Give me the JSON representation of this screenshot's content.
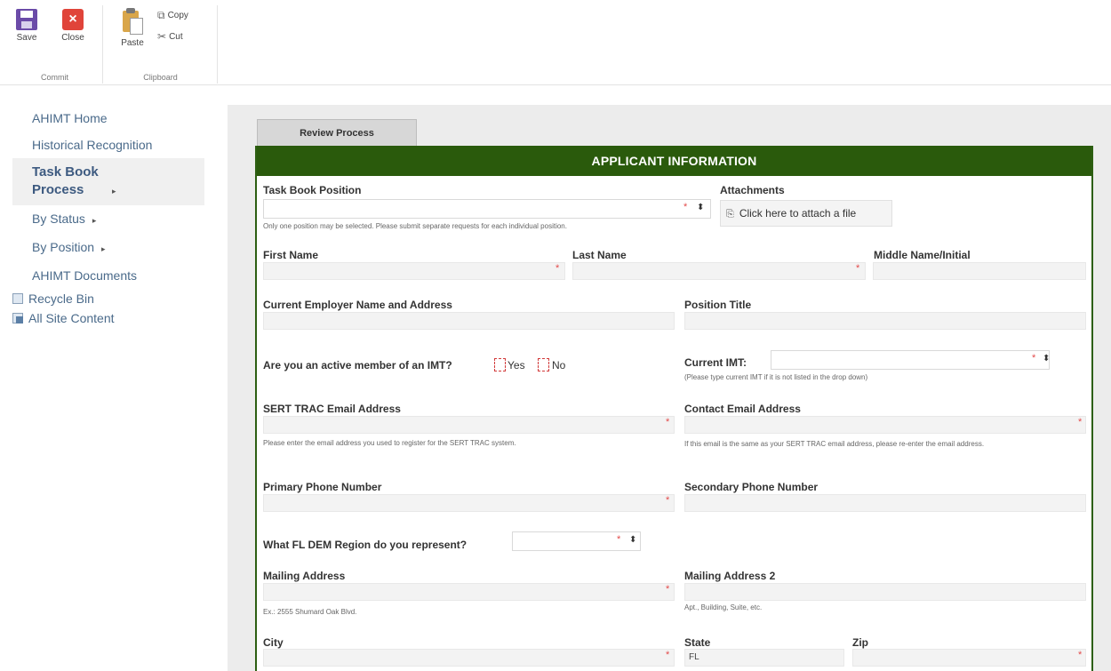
{
  "ribbon": {
    "commit": {
      "save": "Save",
      "close": "Close",
      "label": "Commit"
    },
    "clipboard": {
      "paste": "Paste",
      "copy": "Copy",
      "cut": "Cut",
      "label": "Clipboard"
    }
  },
  "nav": {
    "items": [
      {
        "label": "AHIMT Home"
      },
      {
        "label": "Historical Recognition"
      },
      {
        "label": "Task Book Process",
        "selected": true
      },
      {
        "label": "By Status"
      },
      {
        "label": "By Position"
      },
      {
        "label": "AHIMT Documents"
      }
    ],
    "recycle_bin": "Recycle Bin",
    "all_site_content": "All Site Content"
  },
  "tab": {
    "label": "Review Process"
  },
  "form": {
    "header": "APPLICANT INFORMATION",
    "task_book_position": {
      "label": "Task Book Position",
      "help": "Only one position may be selected. Please submit separate requests for each individual position."
    },
    "attachments": {
      "label": "Attachments",
      "link": "Click here to attach a file"
    },
    "first_name": {
      "label": "First Name"
    },
    "last_name": {
      "label": "Last Name"
    },
    "middle_name": {
      "label": "Middle Name/Initial"
    },
    "employer": {
      "label": "Current Employer Name and Address"
    },
    "position_title": {
      "label": "Position Title"
    },
    "imt_member": {
      "label": "Are you an active member of an IMT?",
      "yes": "Yes",
      "no": "No"
    },
    "current_imt": {
      "label": "Current IMT:",
      "help": "(Please type current IMT if it is not listed in the drop down)"
    },
    "sert_email": {
      "label": "SERT TRAC Email Address",
      "help": "Please enter the email address you used to register for the SERT TRAC system."
    },
    "contact_email": {
      "label": "Contact Email Address",
      "help": "If this email is the same as your SERT TRAC email address, please re-enter the email address."
    },
    "primary_phone": {
      "label": "Primary Phone Number"
    },
    "secondary_phone": {
      "label": "Secondary Phone Number"
    },
    "region": {
      "label": "What FL DEM Region do you represent?"
    },
    "mailing_address": {
      "label": "Mailing Address",
      "help": "Ex.: 2555 Shumard Oak Blvd."
    },
    "mailing_address_2": {
      "label": "Mailing Address 2",
      "help": "Apt., Building, Suite, etc."
    },
    "city": {
      "label": "City"
    },
    "state": {
      "label": "State",
      "value": "FL"
    },
    "zip": {
      "label": "Zip"
    }
  },
  "colors": {
    "header_green": "#2a5a0c",
    "required_red": "#e34a4a",
    "nav_link": "#4a6a8a"
  }
}
